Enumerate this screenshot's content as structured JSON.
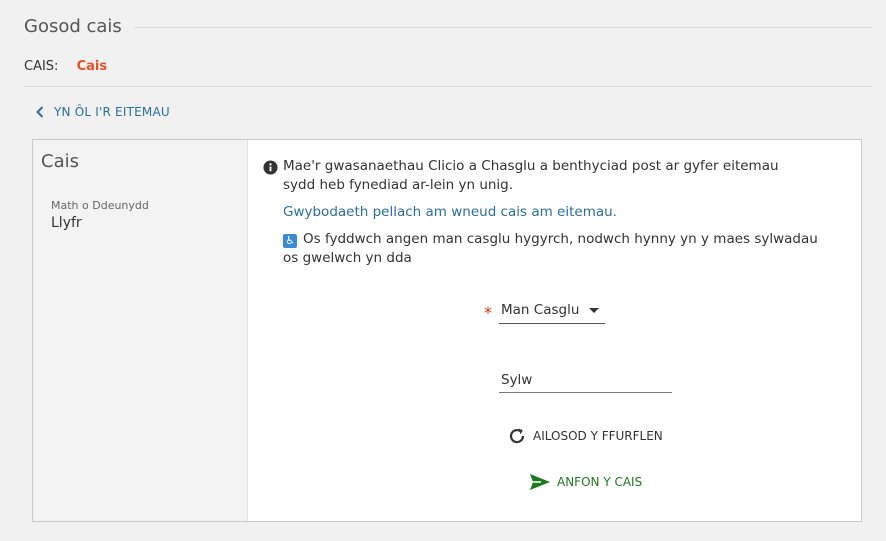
{
  "header": {
    "title": "Gosod cais"
  },
  "request_type": {
    "label": "CAIS:",
    "value": "Cais"
  },
  "back": {
    "label": "YN ÔL I'R EITEMAU"
  },
  "side": {
    "title": "Cais",
    "material_type_label": "Math o Ddeunydd",
    "material_type_value": "Llyfr"
  },
  "main": {
    "info_text": "Mae'r gwasanaethau Clicio a Chasglu a benthyciad post ar gyfer eitemau sydd heb fynediad ar-lein yn unig.",
    "more_info_link": "Gwybodaeth pellach am wneud cais am eitemau.",
    "access_text": "Os fyddwch angen man casglu hygyrch, nodwch hynny yn y maes sylwadau os gwelwch yn dda",
    "pickup": {
      "label": "Man Casglu",
      "required_mark": "*"
    },
    "comment": {
      "placeholder": "Sylw"
    },
    "reset_label": "AILOSOD Y FFURFLEN",
    "send_label": "ANFON Y CAIS"
  },
  "colors": {
    "accent": "#e8502a",
    "link": "#2a6f9a",
    "send": "#1f7a1f",
    "required": "#d9301c"
  },
  "icons": {
    "back": "chevron-left-icon",
    "info": "info-circle-icon",
    "access": "wheelchair-icon",
    "reset": "refresh-icon",
    "send": "paper-plane-icon"
  }
}
